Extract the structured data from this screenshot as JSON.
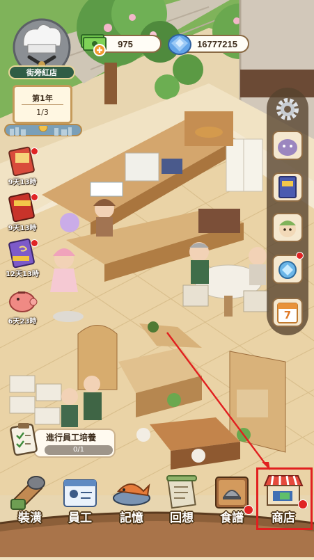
{
  "currency": {
    "cash": "975",
    "gems": "16777215"
  },
  "shop": {
    "name": "街旁紅店",
    "year_label": "第1年",
    "progress": "1/3"
  },
  "timers": [
    {
      "label": "9天13時",
      "icon": "event-book-icon"
    },
    {
      "label": "9天13時",
      "icon": "limited-book-icon"
    },
    {
      "label": "12天13時",
      "icon": "purple-book-icon"
    },
    {
      "label": "6天23時",
      "icon": "piggy-bank-icon"
    }
  ],
  "side_menu": [
    "settings-gear-icon",
    "pet-icon",
    "puzzle-book-icon",
    "character-icon",
    "gem-crystal-icon",
    "calendar-icon"
  ],
  "side_calendar_day": "7",
  "task": {
    "title": "進行員工培養",
    "progress": "0/1"
  },
  "nav": [
    {
      "label": "裝潢",
      "icon": "decor-icon"
    },
    {
      "label": "員工",
      "icon": "staff-card-icon"
    },
    {
      "label": "記憶",
      "icon": "memory-fish-icon"
    },
    {
      "label": "回想",
      "icon": "scroll-icon"
    },
    {
      "label": "食譜",
      "icon": "recipe-book-icon"
    },
    {
      "label": "商店",
      "icon": "shop-stall-icon"
    }
  ],
  "colors": {
    "highlight": "#e11f1f",
    "badge": "#e02424",
    "shop_name_bg": "#2f5d45"
  }
}
